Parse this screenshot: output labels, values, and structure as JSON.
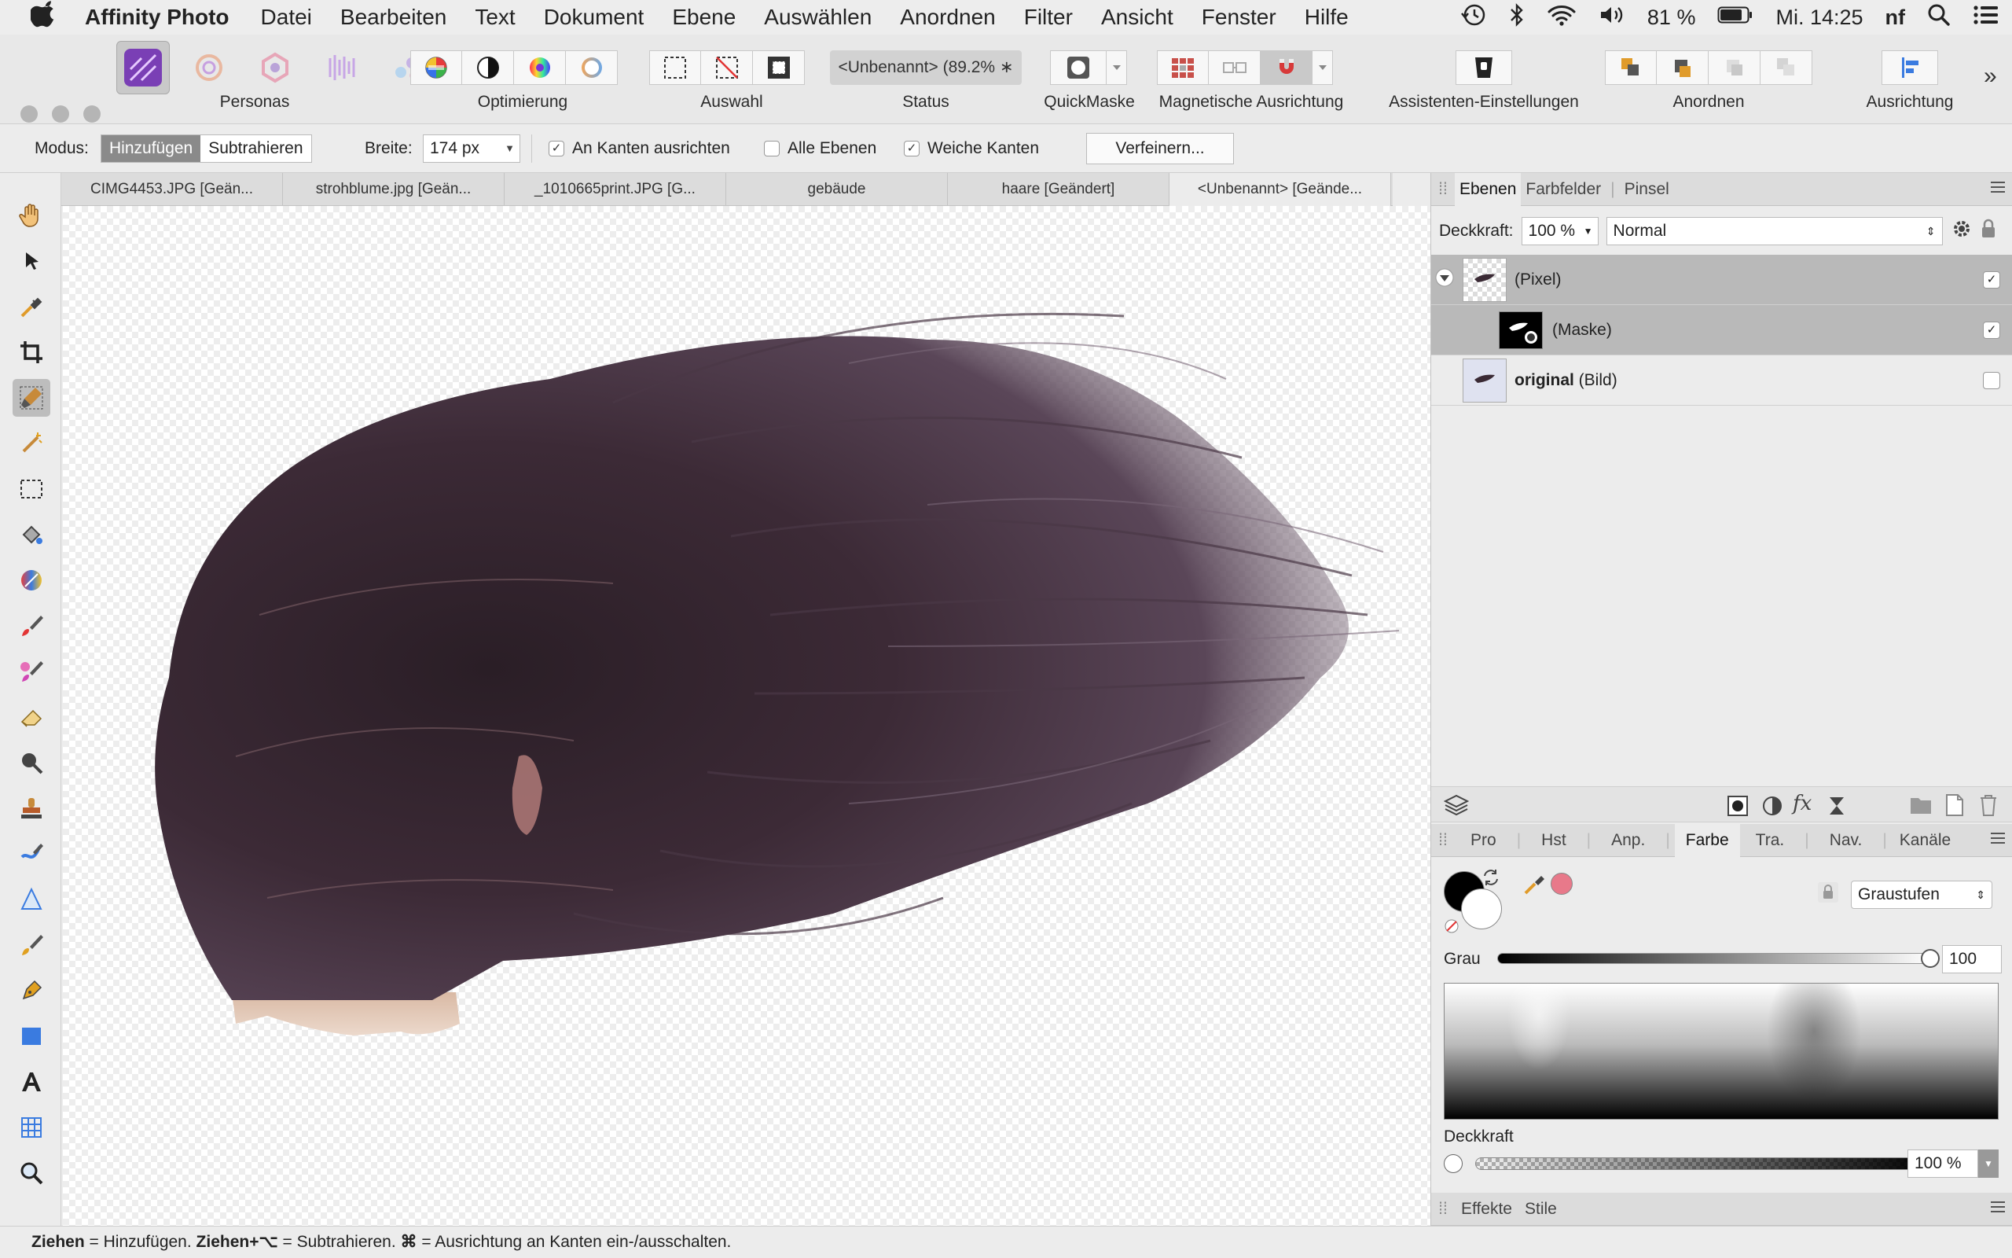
{
  "menubar": {
    "app_name": "Affinity Photo",
    "items": [
      "Datei",
      "Bearbeiten",
      "Text",
      "Dokument",
      "Ebene",
      "Auswählen",
      "Anordnen",
      "Filter",
      "Ansicht",
      "Fenster",
      "Hilfe"
    ],
    "battery": "81 %",
    "clock": "Mi. 14:25",
    "user": "nf"
  },
  "toolbar": {
    "personas_label": "Personas",
    "optimierung_label": "Optimierung",
    "auswahl_label": "Auswahl",
    "status_value": "<Unbenannt> (89.2% ∗",
    "status_label": "Status",
    "quickmask_label": "QuickMaske",
    "snapping_label": "Magnetische Ausrichtung",
    "assistant_label": "Assistenten-Einstellungen",
    "arrange_label": "Anordnen",
    "align_label": "Ausrichtung",
    "overflow": "»"
  },
  "context": {
    "mode_label": "Modus:",
    "mode_add": "Hinzufügen",
    "mode_subtract": "Subtrahieren",
    "width_label": "Breite:",
    "width_value": "174 px",
    "snap_edges": "An Kanten ausrichten",
    "all_layers": "Alle Ebenen",
    "soft_edges": "Weiche Kanten",
    "refine": "Verfeinern..."
  },
  "tabs": [
    {
      "label": "CIMG4453.JPG [Geän..."
    },
    {
      "label": "strohblume.jpg [Geän..."
    },
    {
      "label": "_1010665print.JPG [G..."
    },
    {
      "label": "gebäude"
    },
    {
      "label": "haare [Geändert]"
    },
    {
      "label": "<Unbenannt> [Geände..."
    }
  ],
  "layers_panel": {
    "tabs": [
      "Ebenen",
      "Farbfelder",
      "Pinsel"
    ],
    "opacity_label": "Deckkraft:",
    "opacity_value": "100 %",
    "blend_mode": "Normal",
    "layers": [
      {
        "name": "(Pixel)",
        "visible": true,
        "selected": true
      },
      {
        "name": "(Maske)",
        "visible": true,
        "selected": true
      },
      {
        "name_bold": "original",
        "name_rest": " (Bild)",
        "visible": false,
        "selected": false
      }
    ]
  },
  "color_panel": {
    "tabs": [
      "Pro",
      "Hst",
      "Anp.",
      "Farbe",
      "Tra.",
      "Nav.",
      "Kanäle"
    ],
    "active_tab": "Farbe",
    "model": "Graustufen",
    "grey_label": "Grau",
    "grey_value": "100",
    "opacity_label": "Deckkraft",
    "opacity_value": "100 %",
    "accent_swatch": "#e8798a"
  },
  "effects_panel": {
    "tabs": [
      "Effekte",
      "Stile"
    ]
  },
  "statusbar": {
    "b1": "Ziehen",
    "t1": " = Hinzufügen. ",
    "b2": "Ziehen+⌥",
    "t2": " = Subtrahieren. ",
    "b3": "⌘",
    "t3": " = Ausrichtung an Kanten ein-/ausschalten."
  }
}
